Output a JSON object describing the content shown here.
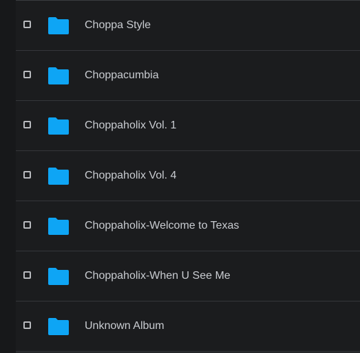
{
  "list": {
    "items": [
      {
        "label": "Choppa Style",
        "icon": "folder-icon"
      },
      {
        "label": "Choppacumbia",
        "icon": "folder-icon"
      },
      {
        "label": "Choppaholix Vol. 1",
        "icon": "folder-icon"
      },
      {
        "label": "Choppaholix Vol. 4",
        "icon": "folder-icon"
      },
      {
        "label": "Choppaholix-Welcome to Texas",
        "icon": "folder-icon"
      },
      {
        "label": "Choppaholix-When U See Me",
        "icon": "folder-icon"
      },
      {
        "label": "Unknown Album",
        "icon": "folder-icon"
      }
    ]
  },
  "colors": {
    "background": "#1b1c1e",
    "folder": "#0ea5f5",
    "text": "#c9ccd1",
    "divider": "#35373b"
  }
}
